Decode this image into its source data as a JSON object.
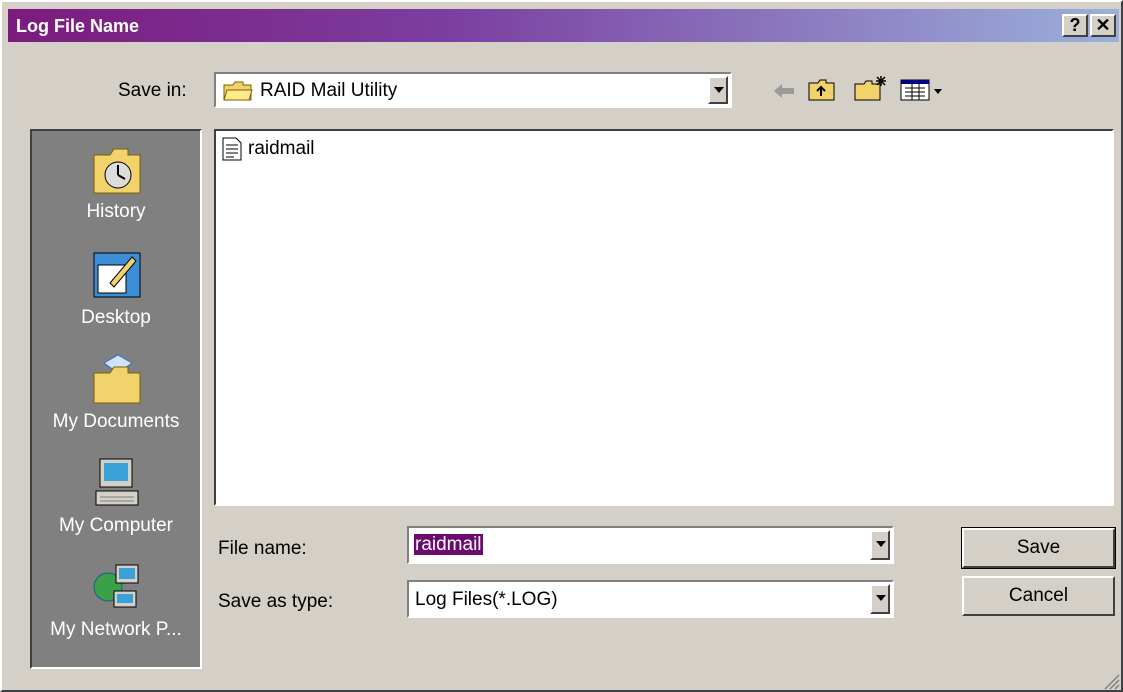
{
  "window": {
    "title": "Log File Name",
    "help_label": "?",
    "close_label": "✕"
  },
  "toolbar": {
    "save_in_label": "Save in:",
    "save_in_value": "RAID Mail Utility"
  },
  "sidebar": {
    "items": [
      {
        "label": "History",
        "icon": "history-icon"
      },
      {
        "label": "Desktop",
        "icon": "desktop-icon"
      },
      {
        "label": "My Documents",
        "icon": "my-documents-icon"
      },
      {
        "label": "My Computer",
        "icon": "my-computer-icon"
      },
      {
        "label": "My Network P...",
        "icon": "network-icon"
      }
    ]
  },
  "files": [
    {
      "name": "raidmail",
      "icon": "text-file-icon"
    }
  ],
  "form": {
    "file_name_label": "File name:",
    "file_name_value": "raidmail",
    "save_as_type_label": "Save as type:",
    "save_as_type_value": "Log Files(*.LOG)"
  },
  "buttons": {
    "save": "Save",
    "cancel": "Cancel"
  },
  "colors": {
    "title_start": "#7b1b7d",
    "title_end": "#9bb0dc",
    "selection": "#6b0a6f",
    "face": "#d4d0c8"
  }
}
